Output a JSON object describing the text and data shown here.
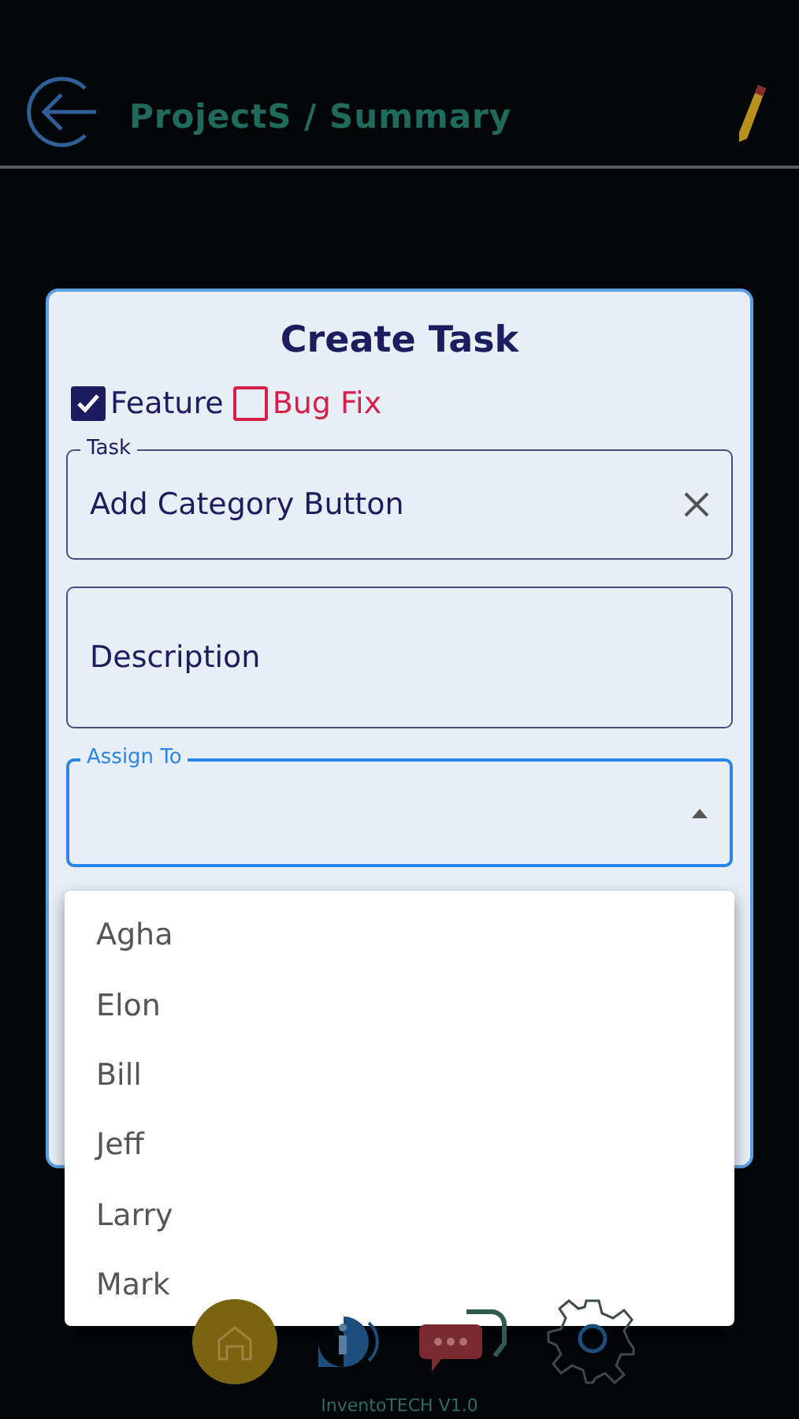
{
  "header": {
    "title": "ProjectS / Summary"
  },
  "dialog": {
    "title": "Create Task",
    "types": [
      {
        "label": "Feature",
        "checked": true,
        "kind": "feature"
      },
      {
        "label": "Bug Fix",
        "checked": false,
        "kind": "bugfix"
      }
    ],
    "task": {
      "label": "Task",
      "value": "Add Category Button"
    },
    "description": {
      "placeholder": "Description"
    },
    "assign_to": {
      "label": "Assign To",
      "expanded": true,
      "options": [
        {
          "label": "Agha"
        },
        {
          "label": "Elon"
        },
        {
          "label": "Bill"
        },
        {
          "label": "Jeff"
        },
        {
          "label": "Larry"
        },
        {
          "label": "Mark"
        }
      ]
    }
  },
  "footer": {
    "version": "InventoTECH V1.0"
  }
}
